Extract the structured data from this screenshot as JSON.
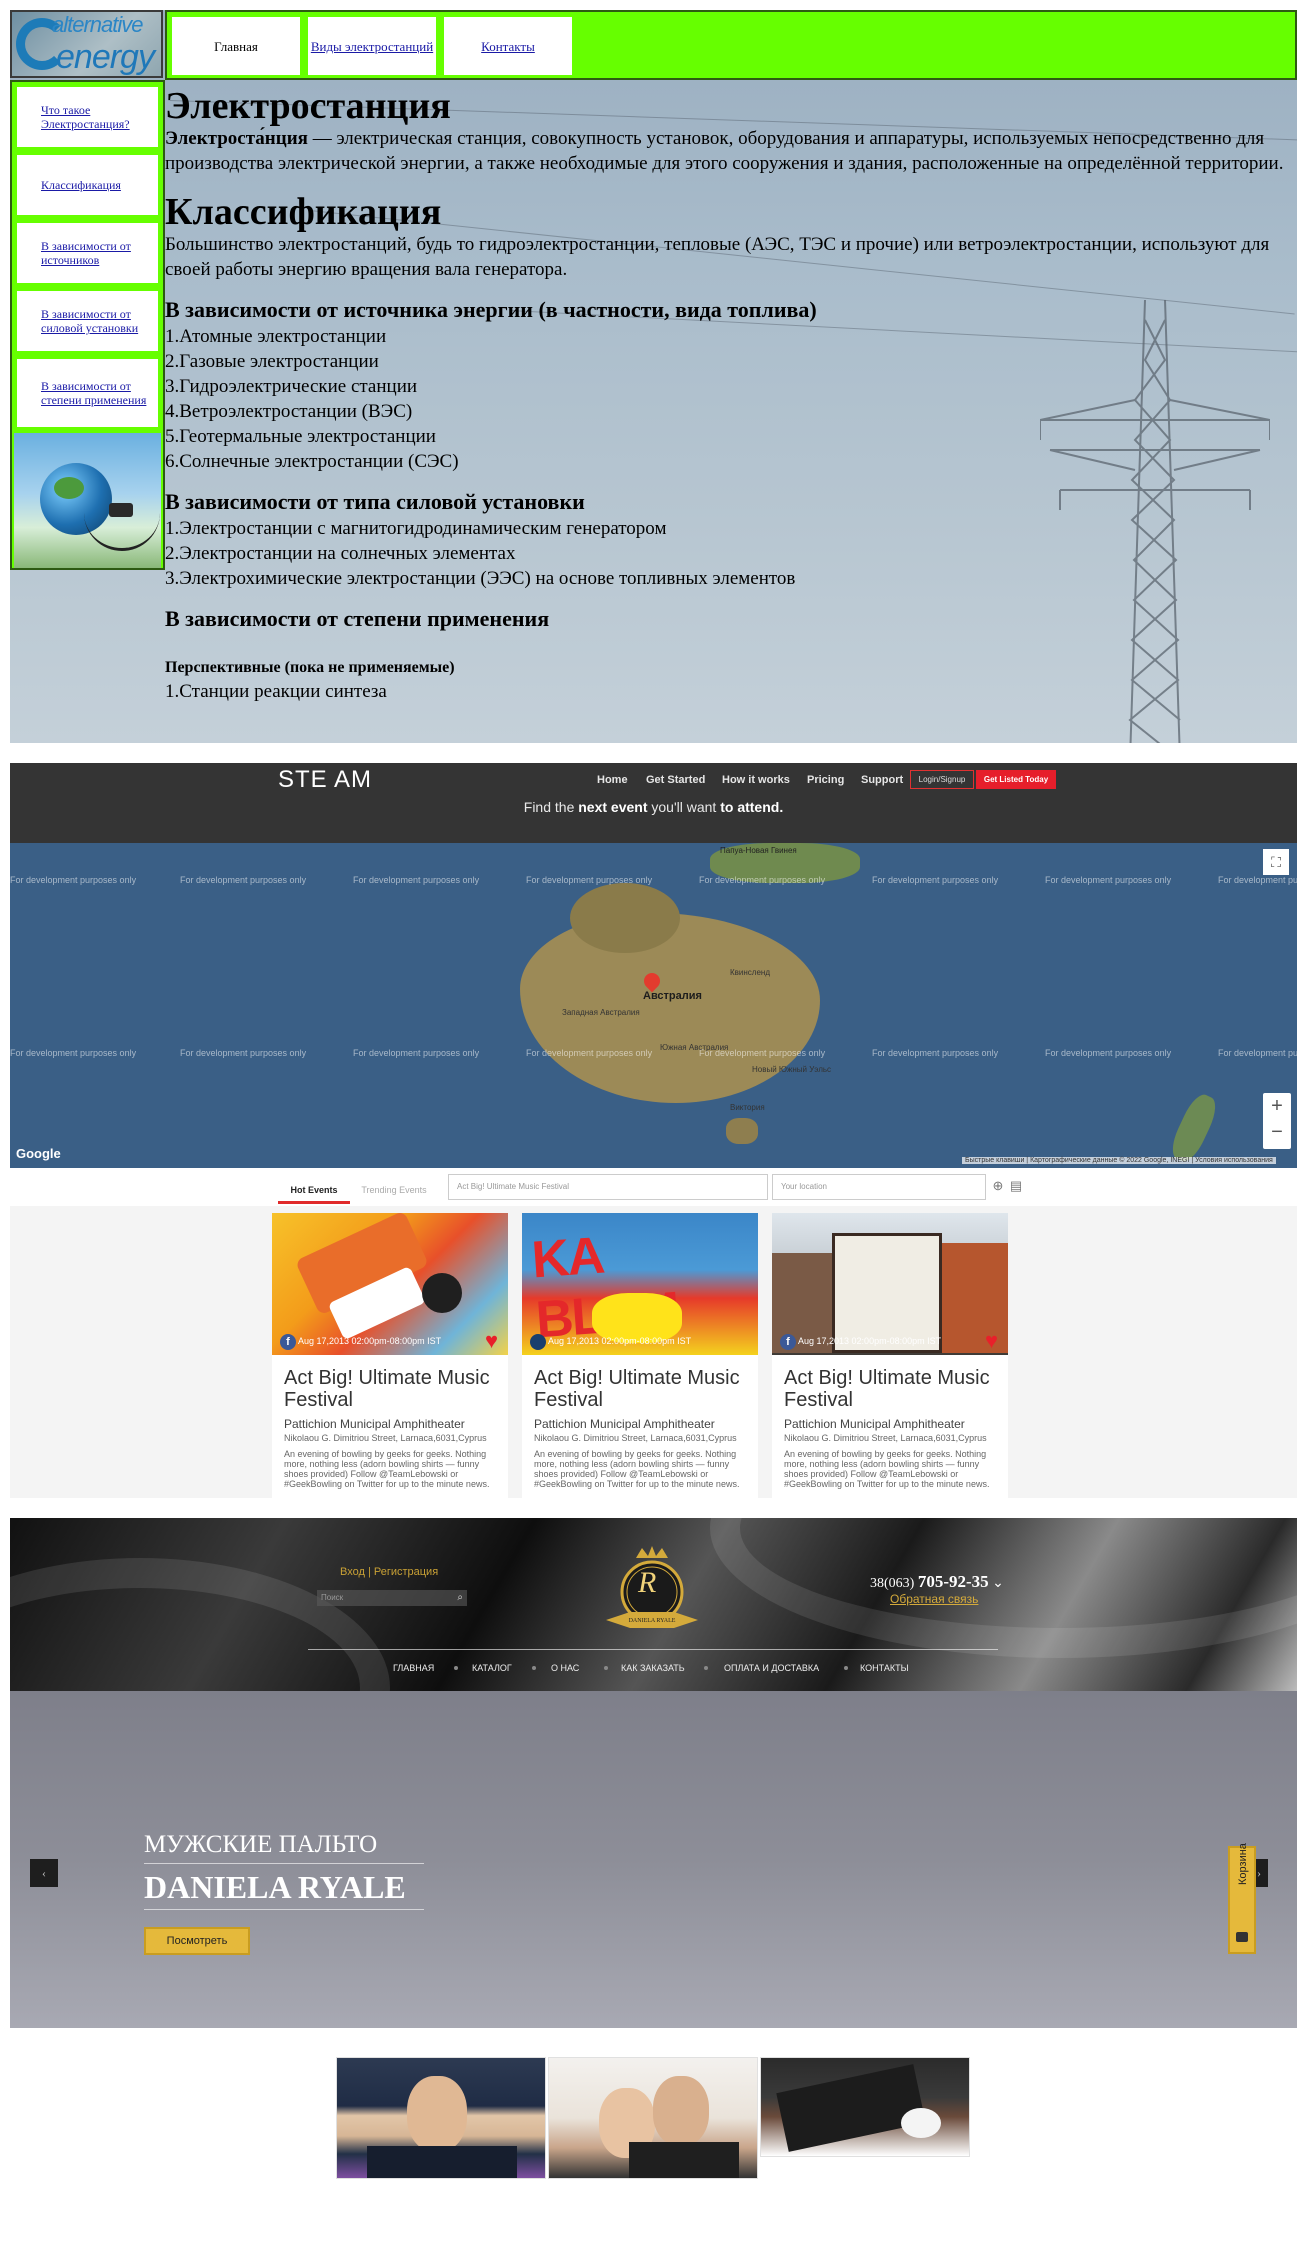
{
  "energy": {
    "logo_text": [
      "alternative",
      "energy"
    ],
    "nav": [
      "Главная",
      "Виды электростанций",
      "Контакты"
    ],
    "sidebar": [
      "Что такое Электростанция?",
      "Классификация",
      "В зависимости от источников",
      "В зависимости от силовой установки",
      "В зависимости от степени применения"
    ],
    "h1": "Электростанция",
    "intro_bold": "Электроста́нция",
    "intro_rest": " — электрическая станция, совокупность установок, оборудования и аппаратуры, используемых непосредственно для производства электрической энергии, а также необходимые для этого сооружения и здания, расположенные на определённой территории.",
    "h1b": "Классификация",
    "class_text": "Большинство электростанций, будь то гидроэлектростанции, тепловые (АЭС, ТЭС и прочие) или ветроэлектростанции, используют для своей работы энергию вращения вала генератора.",
    "h3a": "В зависимости от источника энергии (в частности, вида топлива)",
    "list_a": [
      "1.Атомные электростанции",
      "2.Газовые электростанции",
      "3.Гидроэлектрические станции",
      "4.Ветроэлектростанции (ВЭС)",
      "5.Геотермальные электростанции",
      "6.Солнечные электростанции (СЭС)"
    ],
    "h3b": "В зависимости от типа силовой установки",
    "list_b": [
      "1.Электростанции с магнитогидродинамическим генератором",
      "2.Электростанции на солнечных элементах",
      "3.Электрохимические электростанции (ЭЭС) на основе топливных элементов"
    ],
    "h3c": "В зависимости от степени применения",
    "h4": "Перспективные (пока не применяемые)",
    "list_c": [
      "1.Станции реакции синтеза"
    ]
  },
  "steam": {
    "brand": "STE AM",
    "menu": [
      "Home",
      "Get Started",
      "How it works",
      "Pricing",
      "Support"
    ],
    "login": "Login/Signup",
    "listed": "Get Listed Today",
    "tagline_pre": "Find the ",
    "tagline_bold1": "next event",
    "tagline_mid": " you'll want ",
    "tagline_bold2": "to attend.",
    "map_watermark": "For development purposes only",
    "map_label": "Австралия",
    "map_small": [
      "Папуа-Новая Гвинея",
      "Западная Австралия",
      "Южная Австралия",
      "Виктория",
      "Новый Южный Уэльс",
      "Квинсленд"
    ],
    "google": "Google",
    "map_terms": "Быстрые клавиши | Картографические данные © 2022 Google, INEGI | Условия использования",
    "zoom_in": "+",
    "zoom_out": "−",
    "tab_hot": "Hot Events",
    "tab_trend": "Trending Events",
    "search_placeholder": "Act Big! Ultimate Music Festival",
    "location_placeholder": "Your location",
    "cards": [
      {
        "date": "Aug 17,2013 02:00pm-08:00pm IST",
        "title": "Act Big! Ultimate Music Festival",
        "venue": "Pattichion Municipal Amphitheater",
        "addr": "Nikolaou G. Dimitriou Street, Larnaca,6031,Cyprus",
        "desc": "An evening of bowling by geeks for geeks. Nothing more, nothing less (adorn bowling shirts — funny shoes provided) Follow @TeamLebowski or #GeekBowling on Twitter for up to the minute news."
      },
      {
        "date": "Aug 17,2013 02:00pm-08:00pm IST",
        "title": "Act Big! Ultimate Music Festival",
        "venue": "Pattichion Municipal Amphitheater",
        "addr": "Nikolaou G. Dimitriou Street, Larnaca,6031,Cyprus",
        "desc": "An evening of bowling by geeks for geeks. Nothing more, nothing less (adorn bowling shirts — funny shoes provided) Follow @TeamLebowski or #GeekBowling on Twitter for up to the minute news."
      },
      {
        "date": "Aug 17,2013 02:00pm-08:00pm IST",
        "title": "Act Big! Ultimate Music Festival",
        "venue": "Pattichion Municipal Amphitheater",
        "addr": "Nikolaou G. Dimitriou Street, Larnaca,6031,Cyprus",
        "desc": "An evening of bowling by geeks for geeks. Nothing more, nothing less (adorn bowling shirts — funny shoes provided) Follow @TeamLebowski or #GeekBowling on Twitter for up to the minute news."
      }
    ]
  },
  "ryale": {
    "auth": "Вход | Регистрация",
    "search_placeholder": "Поиск",
    "phone_prefix": "38(063) ",
    "phone_number": "705-92-35",
    "callback": "Обратная связь",
    "logo_letter": "R",
    "logo_ribbon": "DANIELA RYALE",
    "nav": [
      "ГЛАВНАЯ",
      "КАТАЛОГ",
      "О НАС",
      "КАК ЗАКАЗАТЬ",
      "ОПЛАТА И ДОСТАВКА",
      "КОНТАКТЫ"
    ],
    "hero_line1": "МУЖСКИЕ ПАЛЬТО",
    "hero_line2": "DANIELA RYALE",
    "hero_button": "Посмотреть",
    "cart": "Корзина",
    "arrow_left": "‹",
    "arrow_right": "›"
  }
}
